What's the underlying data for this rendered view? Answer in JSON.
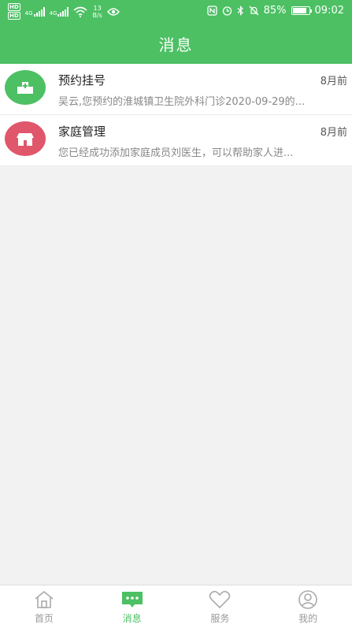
{
  "status_bar": {
    "hd_top": "HD",
    "hd_bottom": "HD",
    "net1": "4G",
    "net2": "4G",
    "speed_value": "13",
    "speed_unit": "B/s",
    "battery_percent": "85%",
    "battery_level": 0.85,
    "time": "09:02"
  },
  "header": {
    "title": "消息"
  },
  "messages": [
    {
      "icon": "hospital-icon",
      "icon_color": "#4cc063",
      "title": "预约挂号",
      "time": "8月前",
      "preview": "吴云,您预约的淮城镇卫生院外科门诊2020-09-29的..."
    },
    {
      "icon": "home-icon",
      "icon_color": "#e0566b",
      "title": "家庭管理",
      "time": "8月前",
      "preview": "您已经成功添加家庭成员刘医生，可以帮助家人进..."
    }
  ],
  "tabbar": {
    "accent": "#4cc063",
    "items": [
      {
        "label": "首页",
        "icon": "home-outline-icon",
        "active": false
      },
      {
        "label": "消息",
        "icon": "message-icon",
        "active": true
      },
      {
        "label": "服务",
        "icon": "heart-icon",
        "active": false
      },
      {
        "label": "我的",
        "icon": "user-icon",
        "active": false
      }
    ]
  }
}
